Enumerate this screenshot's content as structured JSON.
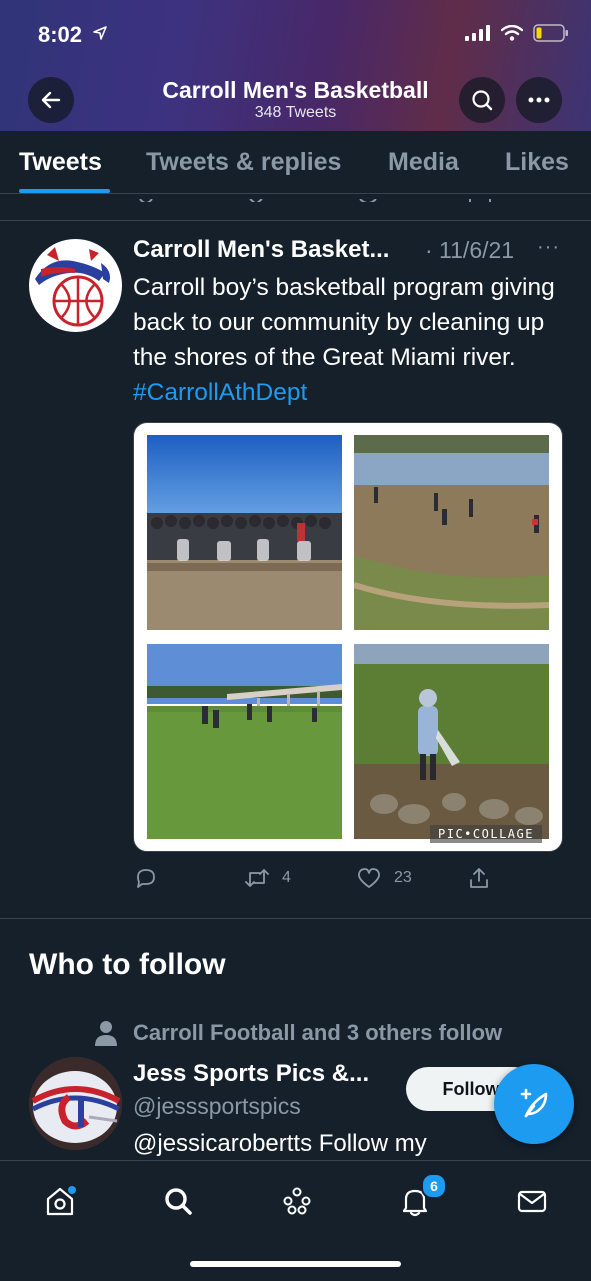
{
  "status_bar": {
    "time": "8:02"
  },
  "header": {
    "title": "Carroll Men's Basketball",
    "subtitle": "348 Tweets"
  },
  "tabs": [
    {
      "label": "Tweets",
      "active": true
    },
    {
      "label": "Tweets & replies",
      "active": false
    },
    {
      "label": "Media",
      "active": false
    },
    {
      "label": "Likes",
      "active": false
    }
  ],
  "tweet": {
    "author": "Carroll Men's Basket...",
    "date": "· 11/6/21",
    "more": "···",
    "text": "Carroll boy’s basketball program giving back to our community by cleaning up the shores of the Great Miami river. ",
    "hashtag": "#CarrollAthDept",
    "collage_watermark": "PIC•COLLAGE",
    "retweets": "4",
    "likes": "23"
  },
  "who_to_follow": {
    "title": "Who to follow",
    "social_context": "Carroll Football and 3 others follow",
    "suggestion": {
      "name": "Jess Sports Pics &...",
      "handle": "@jesssportspics",
      "bio": "@jessicarobertts Follow my",
      "follow_label": "Follow"
    }
  },
  "bottom_nav": {
    "items": [
      "home-icon",
      "search-icon",
      "spaces-icon",
      "notifications-icon",
      "messages-icon"
    ],
    "notifications_badge": "6"
  },
  "colors": {
    "accent": "#1d9bf0",
    "background": "#15202b",
    "muted": "#8b98a5"
  }
}
